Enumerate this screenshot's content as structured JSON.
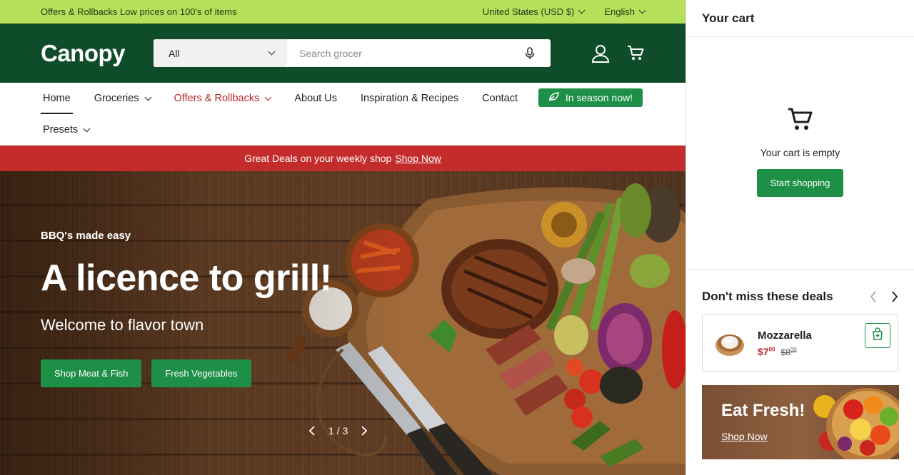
{
  "promo_bar": {
    "offer_text": "Offers & Rollbacks Low prices on 100's of items",
    "currency": "United States (USD $)",
    "language": "English"
  },
  "header": {
    "logo": "Canopy",
    "search_category": "All",
    "search_placeholder": "Search grocer"
  },
  "nav": {
    "items": [
      {
        "label": "Home"
      },
      {
        "label": "Groceries"
      },
      {
        "label": "Offers & Rollbacks"
      },
      {
        "label": "About Us"
      },
      {
        "label": "Inspiration & Recipes"
      },
      {
        "label": "Contact"
      },
      {
        "label": "Presets"
      }
    ],
    "season_button": "In season now!"
  },
  "announcement": {
    "text": "Great Deals on your weekly shop",
    "link": "Shop Now"
  },
  "hero": {
    "eyebrow": "BBQ's made easy",
    "title": "A licence to grill!",
    "subtitle": "Welcome to flavor town",
    "buttons": [
      "Shop Meat & Fish",
      "Fresh Vegetables"
    ],
    "pagination": "1 / 3"
  },
  "cart": {
    "title": "Your cart",
    "empty_message": "Your cart is empty",
    "start_button": "Start shopping"
  },
  "deals": {
    "title": "Don't miss these deals",
    "product": {
      "name": "Mozzarella",
      "price_now": "$7",
      "price_now_cents": "00",
      "price_was": "$8",
      "price_was_cents": "00"
    },
    "banner": {
      "title": "Eat Fresh!",
      "link": "Shop Now"
    }
  },
  "colors": {
    "promo_green": "#b6e05a",
    "brand_green": "#0f4d2a",
    "button_green": "#1e8f46",
    "sale_red": "#c42b2b"
  }
}
